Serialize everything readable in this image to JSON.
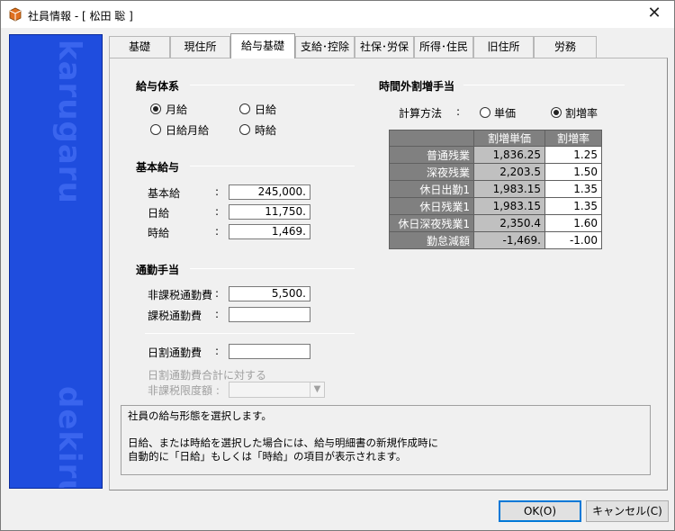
{
  "window": {
    "title": "社員情報 - [ 松田 聡 ]",
    "close_glyph": "✕"
  },
  "sidebar": {
    "word_top": "karugaru",
    "word_bottom": "dekiru"
  },
  "tabs": [
    {
      "label": "基礎"
    },
    {
      "label": "現住所"
    },
    {
      "label": "給与基礎"
    },
    {
      "label": "支給･控除"
    },
    {
      "label": "社保･労保"
    },
    {
      "label": "所得･住民"
    },
    {
      "label": "旧住所"
    },
    {
      "label": "労務"
    }
  ],
  "salary_system": {
    "heading": "給与体系",
    "options": [
      {
        "label": "月給",
        "checked": true
      },
      {
        "label": "日給",
        "checked": false
      },
      {
        "label": "日給月給",
        "checked": false
      },
      {
        "label": "時給",
        "checked": false
      }
    ]
  },
  "base_pay": {
    "heading": "基本給与",
    "rows": [
      {
        "label": "基本給",
        "colon": ":",
        "value": "245,000."
      },
      {
        "label": "日給",
        "colon": ":",
        "value": "11,750."
      },
      {
        "label": "時給",
        "colon": ":",
        "value": "1,469."
      }
    ]
  },
  "commute": {
    "heading": "通勤手当",
    "nontax_label": "非課税通勤費",
    "nontax_colon": ":",
    "nontax_value": "5,500.",
    "tax_label": "課税通勤費",
    "tax_colon": ":",
    "tax_value": "",
    "daily_label": "日割通勤費",
    "daily_colon": ":",
    "daily_value": "",
    "limit_line1": "日割通勤費合計に対する",
    "limit_line2": "非課税限度額 :",
    "limit_value": ""
  },
  "overtime": {
    "heading": "時間外割増手当",
    "method_label": "計算方法",
    "method_colon": ":",
    "method_options": [
      {
        "label": "単価",
        "checked": false
      },
      {
        "label": "割増率",
        "checked": true
      }
    ],
    "columns": [
      "",
      "割増単価",
      "割増率"
    ],
    "rows": [
      {
        "name": "普通残業",
        "unit": "1,836.25",
        "rate": "1.25"
      },
      {
        "name": "深夜残業",
        "unit": "2,203.5",
        "rate": "1.50"
      },
      {
        "name": "休日出勤1",
        "unit": "1,983.15",
        "rate": "1.35"
      },
      {
        "name": "休日残業1",
        "unit": "1,983.15",
        "rate": "1.35"
      },
      {
        "name": "休日深夜残業1",
        "unit": "2,350.4",
        "rate": "1.60"
      },
      {
        "name": "勤怠減額",
        "unit": "-1,469.",
        "rate": "-1.00"
      }
    ]
  },
  "help": {
    "line1": "社員の給与形態を選択します。",
    "line2": "",
    "line3": "日給、または時給を選択した場合には、給与明細書の新規作成時に",
    "line4": "自動的に「日給」もしくは「時給」の項目が表示されます。"
  },
  "buttons": {
    "ok": "OK(O)",
    "cancel": "キャンセル(C)"
  }
}
